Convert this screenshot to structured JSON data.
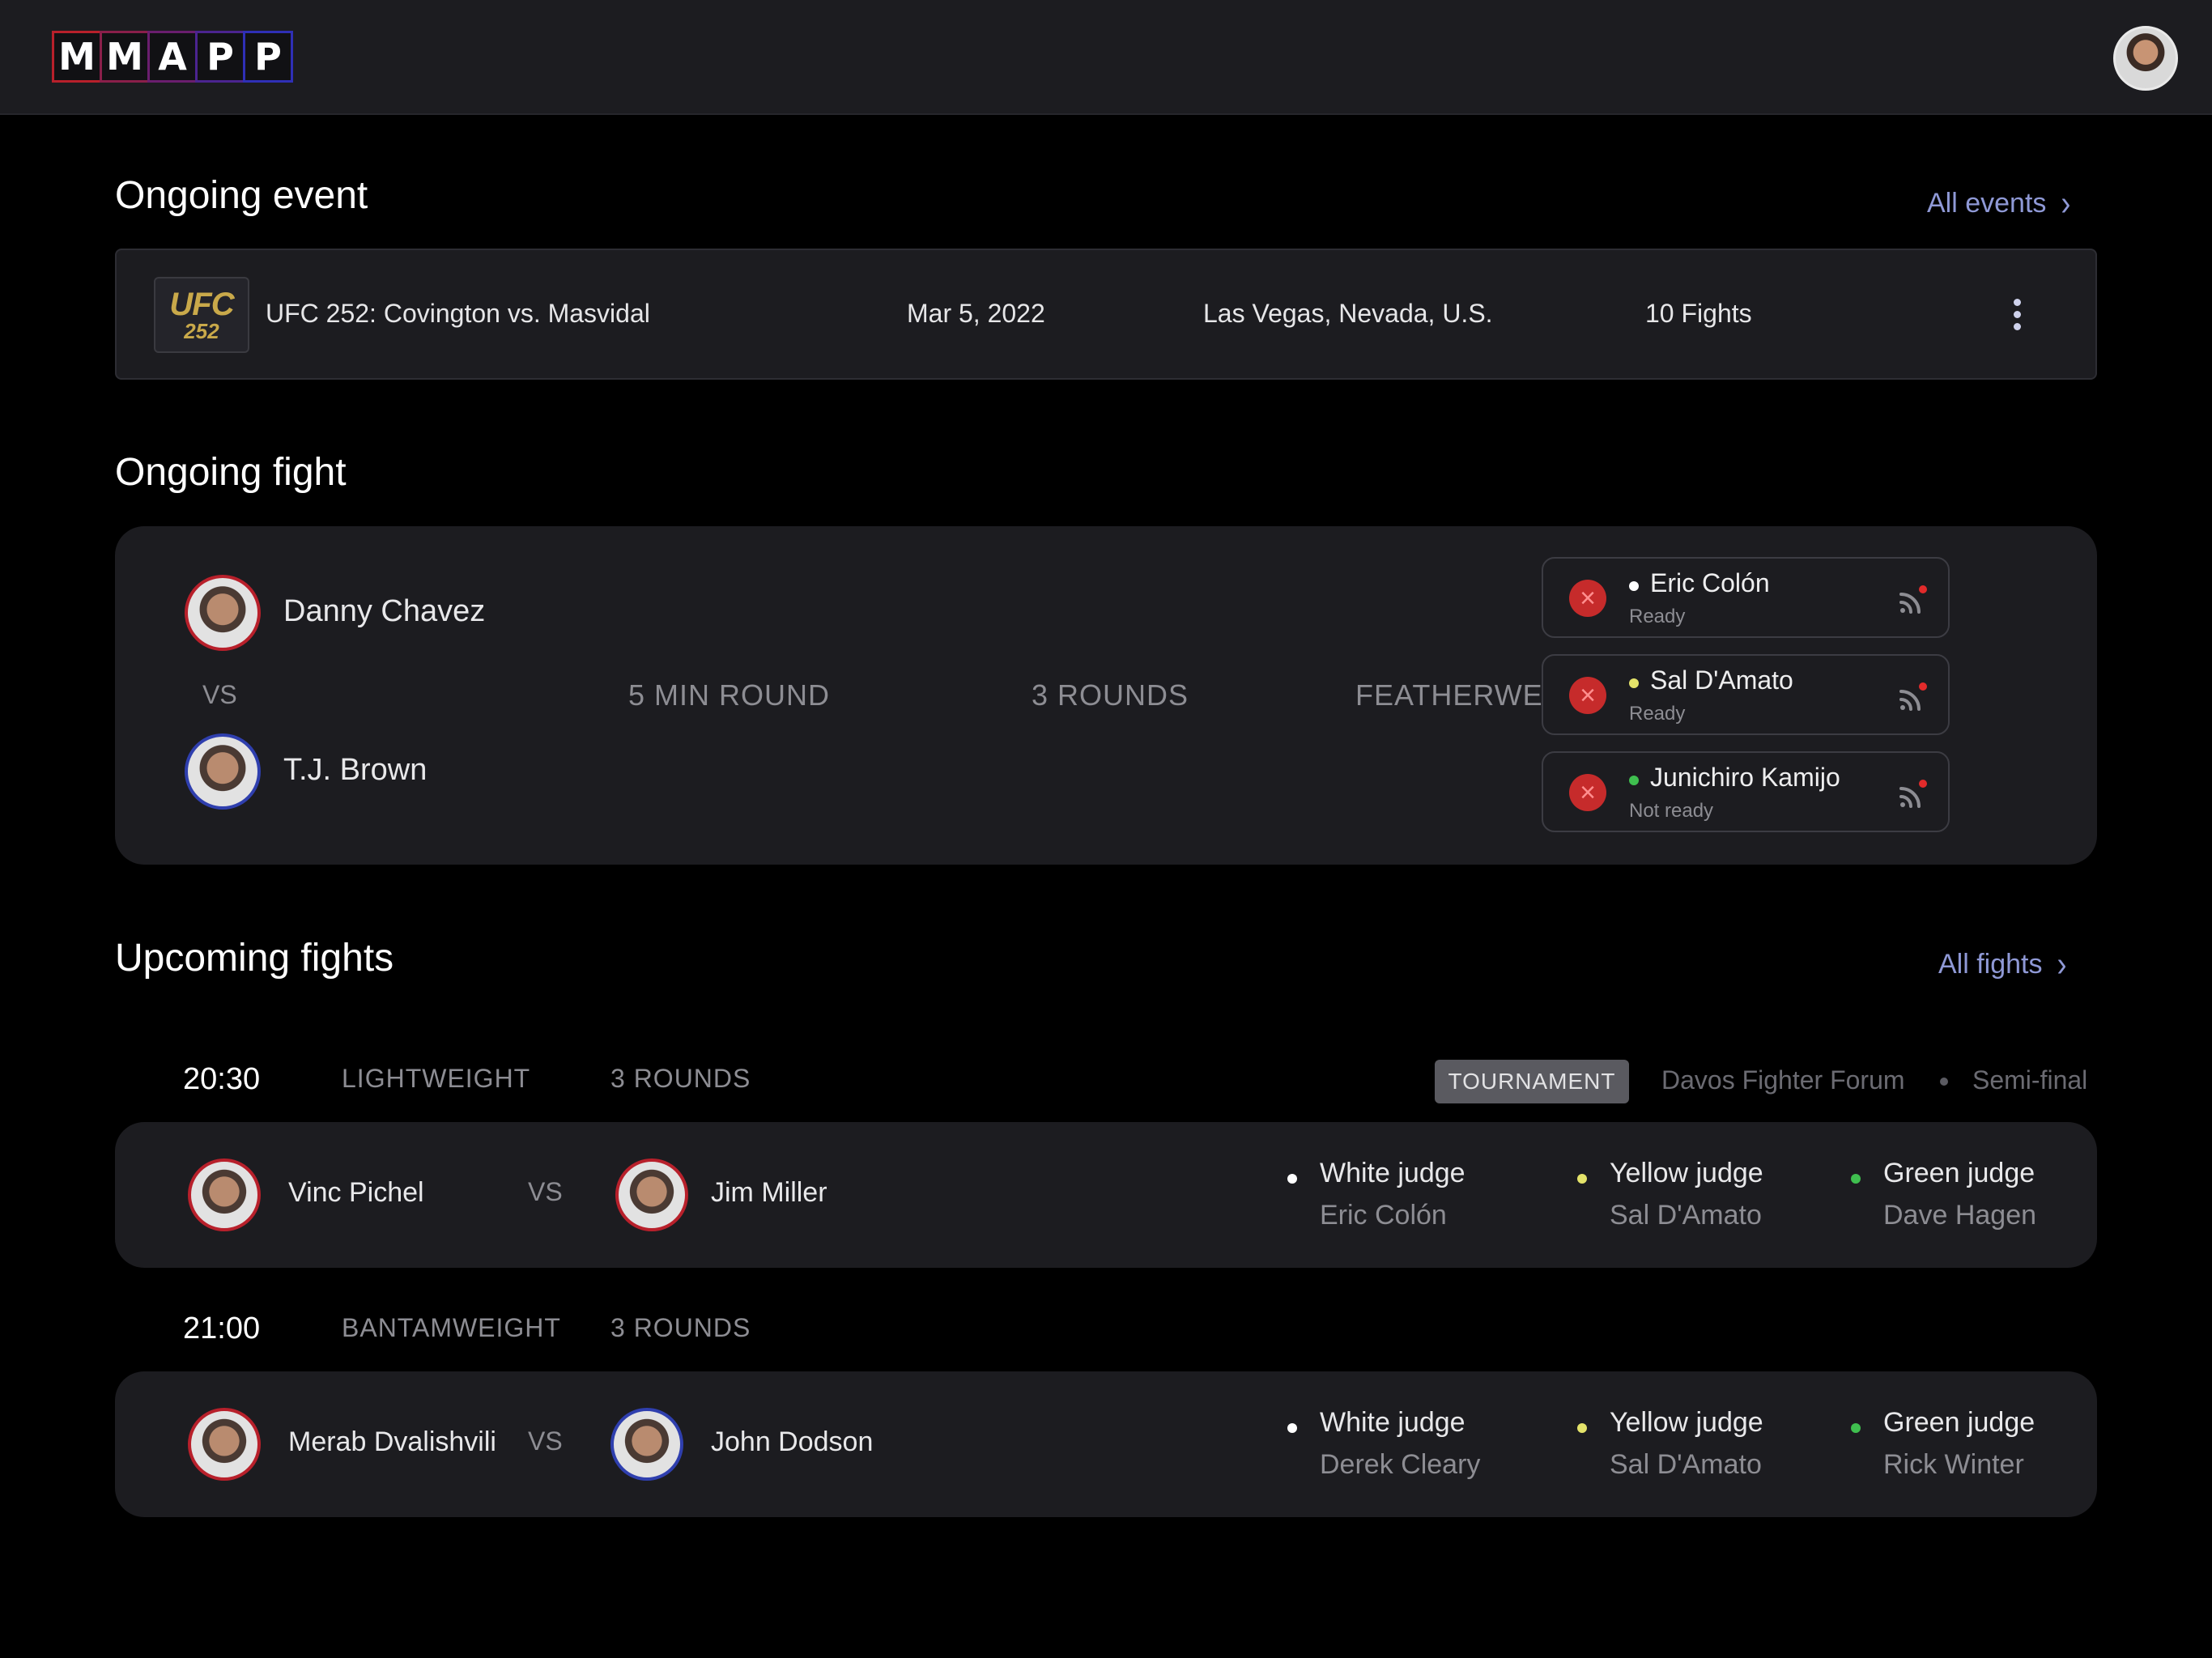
{
  "header": {
    "logo_letters": [
      "M",
      "M",
      "A",
      "P",
      "P"
    ]
  },
  "ongoing_event": {
    "title": "Ongoing event",
    "all_link": "All events",
    "event": {
      "logo_line1": "UFC",
      "logo_line2": "252",
      "name": "UFC 252: Covington vs. Masvidal",
      "date": "Mar 5, 2022",
      "location": "Las Vegas, Nevada, U.S.",
      "fights": "10 Fights"
    }
  },
  "ongoing_fight": {
    "title": "Ongoing fight",
    "fighter_red": "Danny Chavez",
    "vs": "VS",
    "fighter_blue": "T.J. Brown",
    "round_length": "5 MIN ROUND",
    "rounds": "3 ROUNDS",
    "weight_class": "FEATHERWEIGHT",
    "judges": [
      {
        "name": "Eric Colón",
        "status": "Ready",
        "dot_color": "#ffffff"
      },
      {
        "name": "Sal D'Amato",
        "status": "Ready",
        "dot_color": "#e4e36a"
      },
      {
        "name": "Junichiro Kamijo",
        "status": "Not ready",
        "dot_color": "#3fbf4f"
      }
    ]
  },
  "upcoming": {
    "title": "Upcoming fights",
    "all_link": "All fights",
    "fights": [
      {
        "time": "20:30",
        "weight_class": "LIGHTWEIGHT",
        "rounds": "3 ROUNDS",
        "tournament_badge": "TOURNAMENT",
        "tournament_name": "Davos Fighter Forum",
        "stage": "Semi-final",
        "fighter_red": "Vinc Pichel",
        "vs": "VS",
        "fighter_blue": "Jim Miller",
        "judges": [
          {
            "role": "White judge",
            "name": "Eric Colón",
            "dot_color": "#ffffff"
          },
          {
            "role": "Yellow judge",
            "name": "Sal D'Amato",
            "dot_color": "#e4e36a"
          },
          {
            "role": "Green judge",
            "name": "Dave Hagen",
            "dot_color": "#3fbf4f"
          }
        ]
      },
      {
        "time": "21:00",
        "weight_class": "BANTAMWEIGHT",
        "rounds": "3 ROUNDS",
        "fighter_red": "Merab Dvalishvili",
        "vs": "VS",
        "fighter_blue": "John Dodson",
        "judges": [
          {
            "role": "White judge",
            "name": "Derek Cleary",
            "dot_color": "#ffffff"
          },
          {
            "role": "Yellow judge",
            "name": "Sal D'Amato",
            "dot_color": "#e4e36a"
          },
          {
            "role": "Green judge",
            "name": "Rick Winter",
            "dot_color": "#3fbf4f"
          }
        ]
      }
    ]
  },
  "colors": {
    "accent_link": "#8f99d6",
    "red_corner": "#b8202b",
    "blue_corner": "#2f3fae",
    "error": "#c62b2b"
  },
  "icons": {
    "chevron": "chevron-right-icon",
    "menu": "more-vertical-icon",
    "remove": "close-circle-icon",
    "signal": "signal-icon"
  }
}
